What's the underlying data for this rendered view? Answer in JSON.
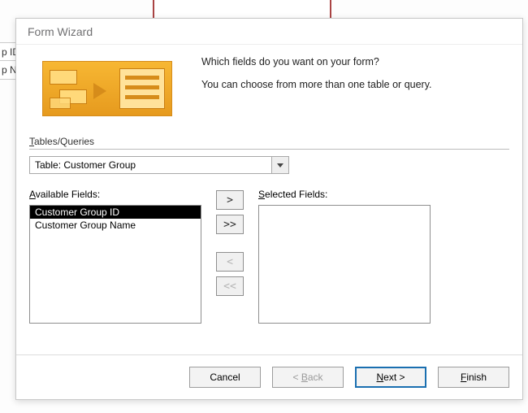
{
  "bg": {
    "frag0": "p ID",
    "frag1": "p Nar"
  },
  "dialog": {
    "title": "Form Wizard",
    "intro1": "Which fields do you want on your form?",
    "intro2": "You can choose from more than one table or query.",
    "tablesQueries": {
      "prefix": "T",
      "rest": "ables/Queries"
    },
    "combo": {
      "value": "Table: Customer Group"
    },
    "available": {
      "prefix": "A",
      "rest": "vailable Fields:",
      "items": [
        "Customer Group ID",
        "Customer Group Name"
      ],
      "selectedIndex": 0
    },
    "selected": {
      "prefix": "S",
      "rest": "elected Fields:",
      "items": []
    },
    "movers": {
      "add": ">",
      "addAll": ">>",
      "remove": "<",
      "removeAll": "<<"
    },
    "buttons": {
      "cancel": "Cancel",
      "back": {
        "lt": "< ",
        "u": "B",
        "rest": "ack"
      },
      "next": {
        "u": "N",
        "rest": "ext >"
      },
      "finish": {
        "u": "F",
        "rest": "inish"
      }
    }
  }
}
